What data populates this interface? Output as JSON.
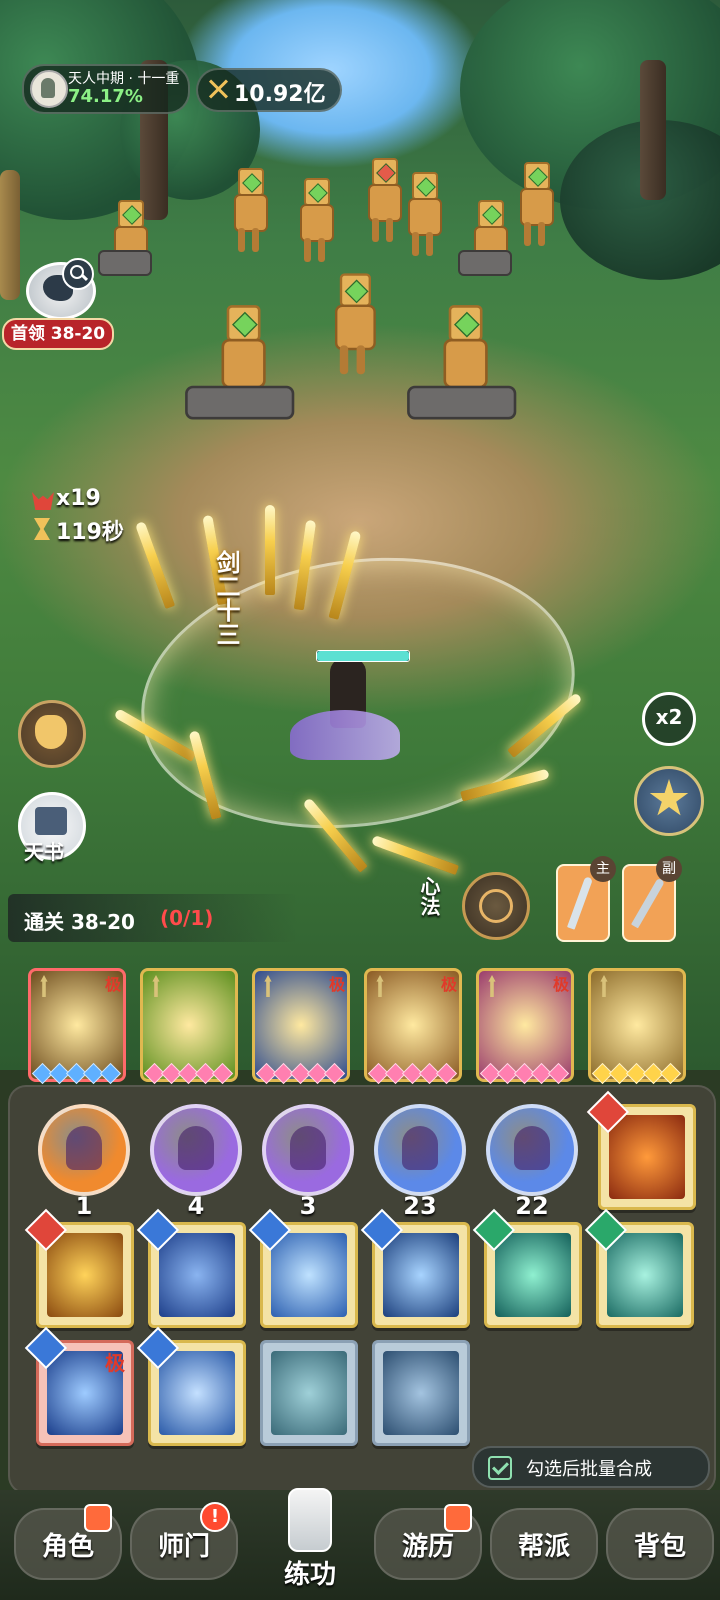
{
  "status": {
    "cultivation_label": "天人中期 · 十一重",
    "cultivation_percent": "74.17%",
    "power_value": "10.92亿"
  },
  "boss": {
    "label": "首领 38-20"
  },
  "battle": {
    "kill_count": "x19",
    "timer": "119秒",
    "combo_text": "剑二十三",
    "speed": "x2"
  },
  "side_buttons": {
    "tianshu_label": "天书",
    "xinfa_label": "心法",
    "main_weapon_tag": "主",
    "sub_weapon_tag": "副"
  },
  "stage": {
    "label": "通关 38-20",
    "progress": "(0/1)"
  },
  "skill_strip": [
    {
      "tag": "极",
      "color": "#6b4a1d"
    },
    {
      "tag": "",
      "color": "#5c8f1e"
    },
    {
      "tag": "极",
      "color": "#2d4a8e"
    },
    {
      "tag": "极",
      "color": "#8a5a24"
    },
    {
      "tag": "极",
      "color": "#9a3c6d"
    },
    {
      "tag": "",
      "color": "#8b6a2a"
    }
  ],
  "orbs": [
    {
      "count": "1",
      "color": "#f08a2e"
    },
    {
      "count": "4",
      "color": "#9a6ae0"
    },
    {
      "count": "3",
      "color": "#9a6ae0"
    },
    {
      "count": "23",
      "color": "#5c89e8"
    },
    {
      "count": "22",
      "color": "#5c89e8"
    }
  ],
  "inventory": {
    "ji_tag": "极",
    "batch_label": "勾选后批量合成"
  },
  "nav": {
    "role": "角色",
    "sect": "师门",
    "train": "练功",
    "travel": "游历",
    "guild": "帮派",
    "bag": "背包"
  }
}
